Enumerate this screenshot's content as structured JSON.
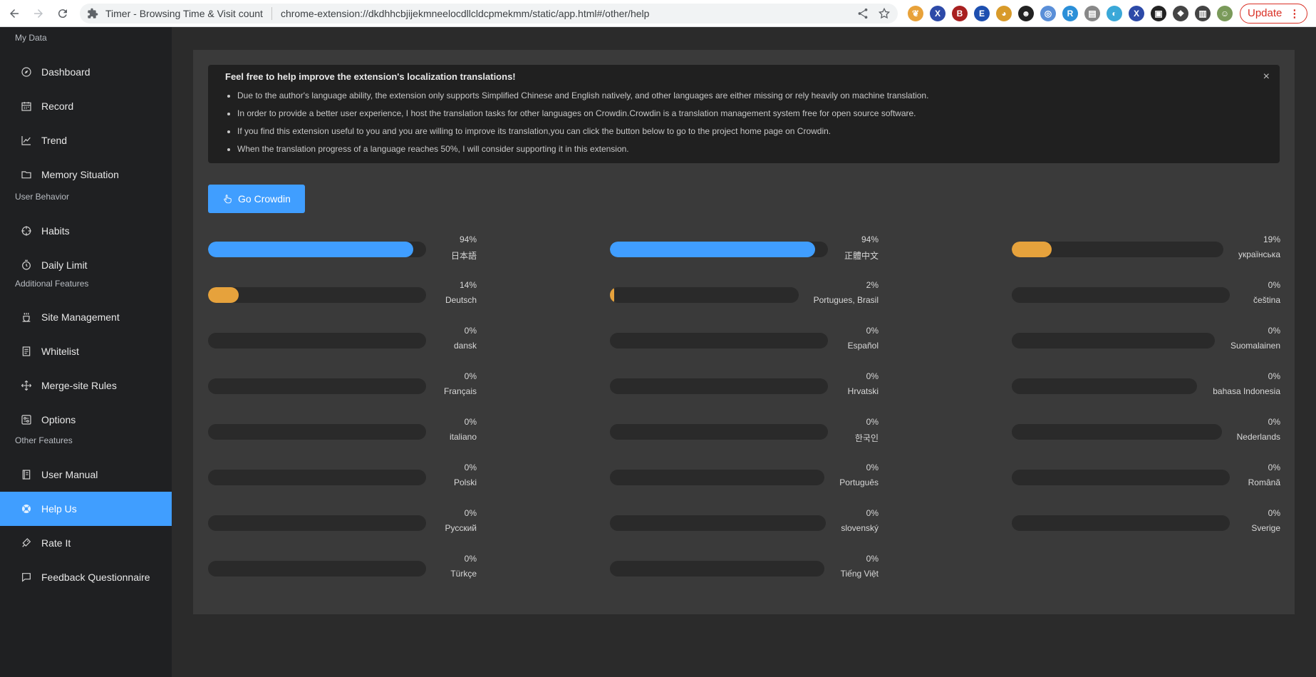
{
  "browser": {
    "tab_title": "Timer - Browsing Time & Visit count",
    "url": "chrome-extension://dkdhhcbjijekmneelocdllcldcpmekmm/static/app.html#/other/help",
    "update_label": "Update",
    "update_menu": "⋮",
    "extensions": [
      {
        "icon": "leaf-ext-icon",
        "glyph": "❦",
        "color": "#e8a23a"
      },
      {
        "icon": "x-ext-icon",
        "glyph": "X",
        "color": "#2d4aa8"
      },
      {
        "icon": "b-ext-icon",
        "glyph": "B",
        "color": "#a82020"
      },
      {
        "icon": "e-ext-icon",
        "glyph": "E",
        "color": "#1d4fb0"
      },
      {
        "icon": "pie-ext-icon",
        "glyph": "◕",
        "color": "#d89a2a"
      },
      {
        "icon": "face-ext-icon",
        "glyph": "☻",
        "color": "#222222"
      },
      {
        "icon": "globe-ext-icon",
        "glyph": "◎",
        "color": "#5a8fd8"
      },
      {
        "icon": "r-ext-icon",
        "glyph": "R",
        "color": "#2b8fd8"
      },
      {
        "icon": "window-ext-icon",
        "glyph": "▤",
        "color": "#888888"
      },
      {
        "icon": "earth-ext-icon",
        "glyph": "◐",
        "color": "#3aa8d8"
      },
      {
        "icon": "x2-ext-icon",
        "glyph": "X",
        "color": "#2d4aa8"
      },
      {
        "icon": "timer-ext-icon",
        "glyph": "▣",
        "color": "#222222"
      },
      {
        "icon": "puzzle-ext-icon",
        "glyph": "❖",
        "color": "#444444"
      },
      {
        "icon": "sidepanel-ext-icon",
        "glyph": "▥",
        "color": "#444444"
      },
      {
        "icon": "avatar-ext-icon",
        "glyph": "☺",
        "color": "#7a9a5a"
      }
    ]
  },
  "sidebar": {
    "groups": [
      {
        "title": "My Data",
        "items": [
          {
            "label": "Dashboard",
            "icon": "compass-icon"
          },
          {
            "label": "Record",
            "icon": "calendar-icon"
          },
          {
            "label": "Trend",
            "icon": "trend-icon"
          },
          {
            "label": "Memory Situation",
            "icon": "folder-icon"
          }
        ]
      },
      {
        "title": "User Behavior",
        "items": [
          {
            "label": "Habits",
            "icon": "aim-icon"
          },
          {
            "label": "Daily Limit",
            "icon": "stopwatch-icon"
          }
        ]
      },
      {
        "title": "Additional Features",
        "items": [
          {
            "label": "Site Management",
            "icon": "cup-icon"
          },
          {
            "label": "Whitelist",
            "icon": "document-icon"
          },
          {
            "label": "Merge-site Rules",
            "icon": "rank-icon"
          },
          {
            "label": "Options",
            "icon": "setting-icon"
          }
        ]
      },
      {
        "title": "Other Features",
        "items": [
          {
            "label": "User Manual",
            "icon": "reading-icon"
          },
          {
            "label": "Help Us",
            "icon": "help-icon",
            "active": true
          },
          {
            "label": "Rate It",
            "icon": "medal-icon"
          },
          {
            "label": "Feedback Questionnaire",
            "icon": "chat-icon"
          }
        ]
      }
    ]
  },
  "alert": {
    "title": "Feel free to help improve the extension's localization translations!",
    "close": "×",
    "items": [
      "Due to the author's language ability, the extension only supports Simplified Chinese and English natively, and other languages are either missing or rely heavily on machine translation.",
      "In order to provide a better user experience, I host the translation tasks for other languages on Crowdin.Crowdin is a translation management system free for open source software.",
      "If you find this extension useful to you and you are willing to improve its translation,you can click the button below to go to the project home page on Crowdin.",
      "When the translation progress of a language reaches 50%, I will consider supporting it in this extension."
    ]
  },
  "go_button": "Go Crowdin",
  "colors": {
    "accent": "#409eff",
    "warning": "#e6a23c"
  },
  "languages": [
    {
      "name": "日本語",
      "pct": "94%",
      "progress": 0.94,
      "status": "accent"
    },
    {
      "name": "正體中文",
      "pct": "94%",
      "progress": 0.94,
      "status": "accent"
    },
    {
      "name": "українська",
      "pct": "19%",
      "progress": 0.19,
      "status": "warning"
    },
    {
      "name": "Deutsch",
      "pct": "14%",
      "progress": 0.14,
      "status": "warning"
    },
    {
      "name": "Portugues, Brasil",
      "pct": "2%",
      "progress": 0.02,
      "status": "warning"
    },
    {
      "name": "čeština",
      "pct": "0%",
      "progress": 0,
      "status": "warning"
    },
    {
      "name": "dansk",
      "pct": "0%",
      "progress": 0,
      "status": "warning"
    },
    {
      "name": "Español",
      "pct": "0%",
      "progress": 0,
      "status": "warning"
    },
    {
      "name": "Suomalainen",
      "pct": "0%",
      "progress": 0,
      "status": "warning"
    },
    {
      "name": "Français",
      "pct": "0%",
      "progress": 0,
      "status": "warning"
    },
    {
      "name": "Hrvatski",
      "pct": "0%",
      "progress": 0,
      "status": "warning"
    },
    {
      "name": "bahasa Indonesia",
      "pct": "0%",
      "progress": 0,
      "status": "warning"
    },
    {
      "name": "italiano",
      "pct": "0%",
      "progress": 0,
      "status": "warning"
    },
    {
      "name": "한국인",
      "pct": "0%",
      "progress": 0,
      "status": "warning"
    },
    {
      "name": "Nederlands",
      "pct": "0%",
      "progress": 0,
      "status": "warning"
    },
    {
      "name": "Polski",
      "pct": "0%",
      "progress": 0,
      "status": "warning"
    },
    {
      "name": "Português",
      "pct": "0%",
      "progress": 0,
      "status": "warning"
    },
    {
      "name": "Română",
      "pct": "0%",
      "progress": 0,
      "status": "warning"
    },
    {
      "name": "Русский",
      "pct": "0%",
      "progress": 0,
      "status": "warning"
    },
    {
      "name": "slovenský",
      "pct": "0%",
      "progress": 0,
      "status": "warning"
    },
    {
      "name": "Sverige",
      "pct": "0%",
      "progress": 0,
      "status": "warning"
    },
    {
      "name": "Türkçe",
      "pct": "0%",
      "progress": 0,
      "status": "warning"
    },
    {
      "name": "Tiếng Việt",
      "pct": "0%",
      "progress": 0,
      "status": "warning"
    }
  ]
}
